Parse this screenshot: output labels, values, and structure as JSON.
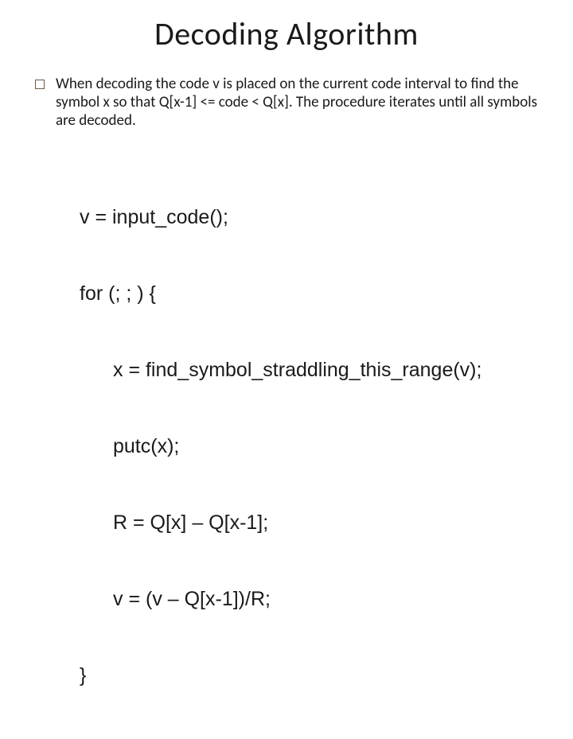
{
  "title": "Decoding Algorithm",
  "bullet": "When decoding the code v is placed on the current code interval to find the symbol x so that Q[x-1] <= code < Q[x]. The procedure iterates until all symbols are decoded.",
  "code": {
    "l1": "v = input_code();",
    "l2": "for (; ; ) {",
    "l3": "x = find_symbol_straddling_this_range(v);",
    "l4": "putc(x);",
    "l5": "R = Q[x] – Q[x-1];",
    "l6": "v = (v – Q[x-1])/R;",
    "l7": "}"
  }
}
